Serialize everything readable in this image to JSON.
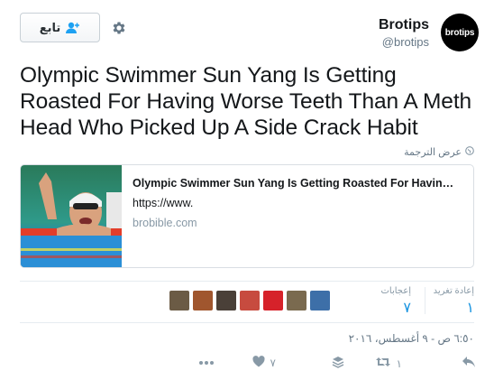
{
  "author": {
    "avatar_text": "brotips",
    "name": "Brotips",
    "handle": "@brotips"
  },
  "follow_button": {
    "label": "تابع"
  },
  "tweet": {
    "text": "Olympic Swimmer Sun Yang Is Getting Roasted For Having Worse Teeth Than A Meth Head Who Picked Up A Side Crack Habit"
  },
  "translate_label": "عرض الترجمة",
  "card": {
    "title": "Olympic Swimmer Sun Yang Is Getting Roasted For Havin…",
    "description": "https://www.",
    "domain": "brobible.com"
  },
  "stats": {
    "retweets_label": "إعادة تغريد",
    "retweets_value": "١",
    "likes_label": "إعجابات",
    "likes_value": "٧"
  },
  "likers": [
    {
      "icon": "avatar-1",
      "color": "#6b5b45"
    },
    {
      "icon": "avatar-2",
      "color": "#a0562e"
    },
    {
      "icon": "avatar-3",
      "color": "#4a4038"
    },
    {
      "icon": "avatar-4",
      "color": "#c74b3f"
    },
    {
      "icon": "avatar-5",
      "color": "#d6222a"
    },
    {
      "icon": "avatar-6",
      "color": "#7a6a4f"
    },
    {
      "icon": "avatar-7",
      "color": "#3d6fa8"
    }
  ],
  "timestamp": "٦:٥٠ ص - ٩ أغسطس، ٢٠١٦",
  "actions": {
    "retweet_count": "١",
    "like_count": "٧"
  },
  "colors": {
    "accent": "#1b95e0",
    "muted": "#8899a6"
  }
}
